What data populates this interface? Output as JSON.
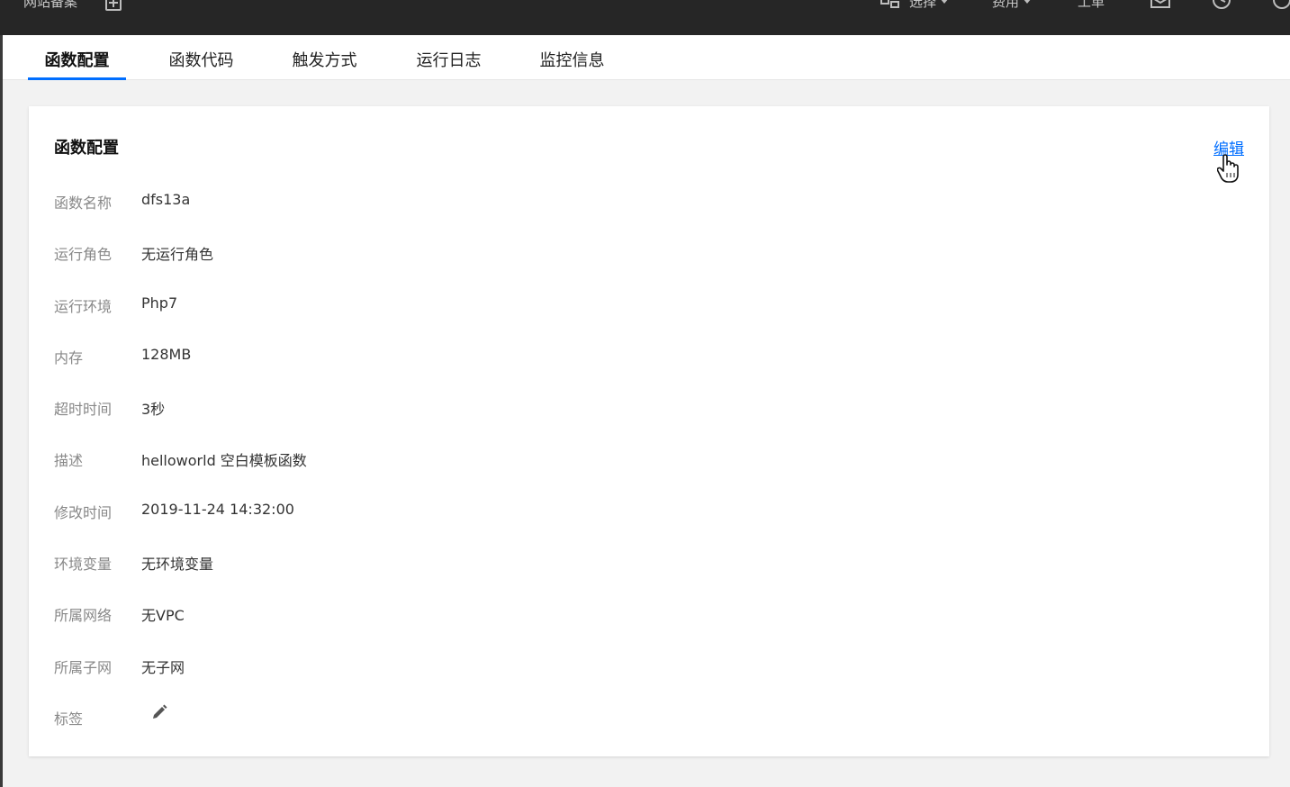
{
  "topbar": {
    "beian_label": "网站备案",
    "items": [
      {
        "label": "选择",
        "has_caret": true
      },
      {
        "label": "费用",
        "has_caret": true
      },
      {
        "label": "工单",
        "has_caret": false
      }
    ],
    "icons": [
      "org-icon",
      "plus-box-icon",
      "mail-icon",
      "clock-icon",
      "help-icon"
    ]
  },
  "tabs": [
    {
      "label": "函数配置",
      "active": true
    },
    {
      "label": "函数代码",
      "active": false
    },
    {
      "label": "触发方式",
      "active": false
    },
    {
      "label": "运行日志",
      "active": false
    },
    {
      "label": "监控信息",
      "active": false
    }
  ],
  "card": {
    "title": "函数配置",
    "edit_label": "编辑",
    "fields": [
      {
        "label": "函数名称",
        "value": "dfs13a"
      },
      {
        "label": "运行角色",
        "value": "无运行角色"
      },
      {
        "label": "运行环境",
        "value": "Php7"
      },
      {
        "label": "内存",
        "value": "128MB"
      },
      {
        "label": "超时时间",
        "value": "3秒"
      },
      {
        "label": "描述",
        "value": "helloworld 空白模板函数"
      },
      {
        "label": "修改时间",
        "value": "2019-11-24 14:32:00"
      },
      {
        "label": "环境变量",
        "value": "无环境变量"
      },
      {
        "label": "所属网络",
        "value": "无VPC"
      },
      {
        "label": "所属子网",
        "value": "无子网"
      },
      {
        "label": "标签",
        "value": ""
      }
    ]
  },
  "colors": {
    "topbar_bg": "#262626",
    "accent": "#006eff",
    "page_bg": "#f2f2f2"
  }
}
